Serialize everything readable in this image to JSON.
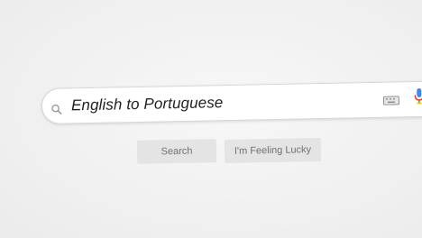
{
  "search": {
    "query": "English to Portuguese"
  },
  "buttons": {
    "search_label": "Search",
    "lucky_label": "I'm Feeling Lucky"
  },
  "icons": {
    "search": "search-icon",
    "keyboard": "keyboard-icon",
    "mic": "microphone-icon"
  },
  "colors": {
    "background": "#f2f2f2",
    "box": "#ffffff",
    "button_bg": "#e4e4e4",
    "button_text": "#707070",
    "query_text": "#222222"
  }
}
